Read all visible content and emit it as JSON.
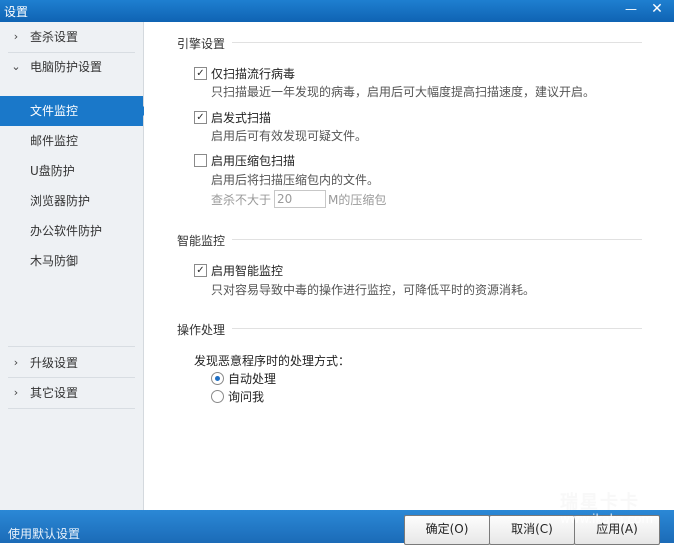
{
  "window": {
    "title": "设置",
    "minimize": "—",
    "close": "✕"
  },
  "sidebar": {
    "items": [
      {
        "label": "查杀设置",
        "chevron": "›"
      },
      {
        "label": "电脑防护设置",
        "chevron": "⌄"
      },
      {
        "label": "文件监控"
      },
      {
        "label": "邮件监控"
      },
      {
        "label": "U盘防护"
      },
      {
        "label": "浏览器防护"
      },
      {
        "label": "办公软件防护"
      },
      {
        "label": "木马防御"
      },
      {
        "label": "升级设置",
        "chevron": "›"
      },
      {
        "label": "其它设置",
        "chevron": "›"
      }
    ]
  },
  "engine": {
    "title": "引擎设置",
    "opt1": {
      "label": "仅扫描流行病毒",
      "desc": "只扫描最近一年发现的病毒，启用后可大幅度提高扫描速度，建议开启。",
      "checked": true
    },
    "opt2": {
      "label": "启发式扫描",
      "desc": "启用后可有效发现可疑文件。",
      "checked": true
    },
    "opt3": {
      "label": "启用压缩包扫描",
      "desc": "启用后将扫描压缩包内的文件。",
      "checked": false
    },
    "size_prefix": "查杀不大于",
    "size_value": "20",
    "size_suffix": "M的压缩包"
  },
  "smart": {
    "title": "智能监控",
    "opt": {
      "label": "启用智能监控",
      "desc": "只对容易导致中毒的操作进行监控，可降低平时的资源消耗。",
      "checked": true
    }
  },
  "action": {
    "title": "操作处理",
    "prompt": "发现恶意程序时的处理方式：",
    "radio1": "自动处理",
    "radio2": "询问我"
  },
  "footer": {
    "default": "使用默认设置",
    "ok": "确定(O)",
    "cancel": "取消(C)",
    "apply": "应用(A)"
  },
  "watermark": {
    "brand": "瑞星卡卡",
    "url": "www.ikaka.com"
  },
  "colors": {
    "titlebar": "#1a74c6",
    "accent": "#1a78c9",
    "sidebar_bg": "#eef1f4"
  }
}
